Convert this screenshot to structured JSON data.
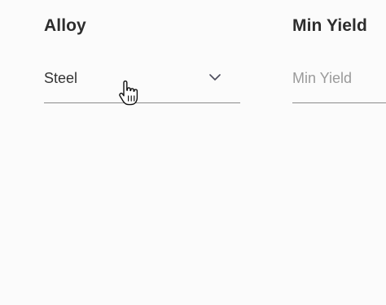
{
  "alloy_field": {
    "label": "Alloy",
    "selected_value": "Steel",
    "dropdown_icon": "chevron-down-icon"
  },
  "min_yield_field": {
    "label": "Min Yield",
    "placeholder": "Min Yield",
    "value": ""
  },
  "pointer": {
    "icon": "hand-pointer-icon"
  },
  "colors": {
    "label_text": "#2d2d2d",
    "value_text": "#333333",
    "placeholder_text": "#9a9a9a",
    "underline": "#8a8a8a",
    "chevron": "#4a4a5a",
    "background": "#fbfbfb"
  }
}
